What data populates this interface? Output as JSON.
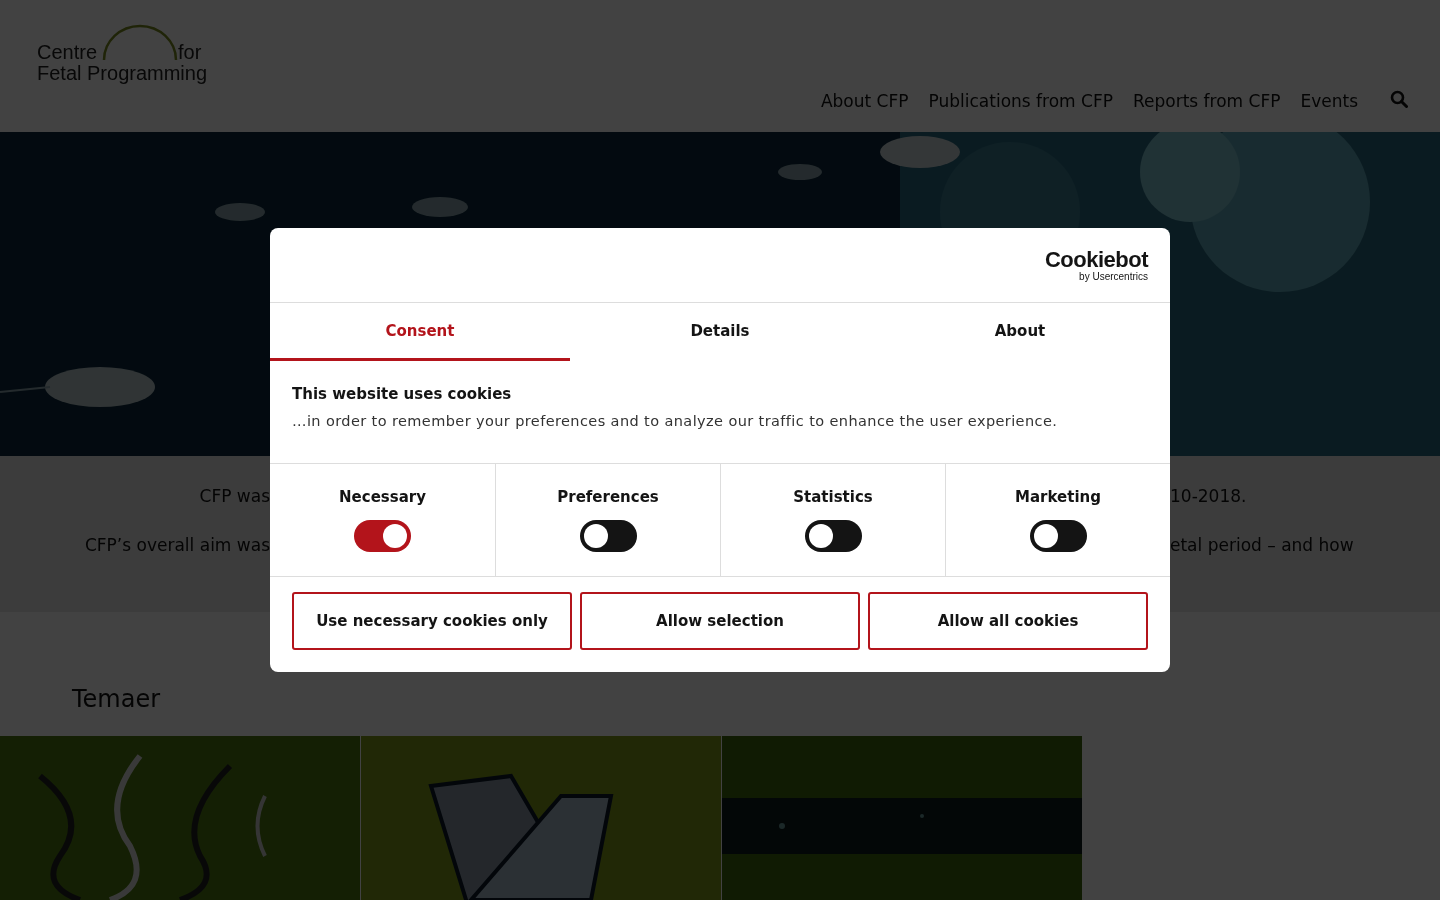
{
  "header": {
    "logo": {
      "line_1": "Centre",
      "line_1_end": "for",
      "line_2": "Fetal Programming"
    },
    "nav": [
      {
        "label": "About CFP"
      },
      {
        "label": "Publications from CFP"
      },
      {
        "label": "Reports from CFP"
      },
      {
        "label": "Events"
      }
    ]
  },
  "intro": {
    "lines": [
      {
        "left": "CFP was",
        "right": "10-2018."
      },
      {
        "left": "CFP’s overall aim was",
        "right": "etal period – and how"
      }
    ]
  },
  "themes": {
    "heading": "Temaer"
  },
  "cookie_dialog": {
    "brand": {
      "name": "Cookiebot",
      "byline": "by Usercentrics"
    },
    "tabs": [
      {
        "label": "Consent",
        "selected": true
      },
      {
        "label": "Details",
        "selected": false
      },
      {
        "label": "About",
        "selected": false
      }
    ],
    "title": "This website uses cookies",
    "description": "…in order to remember your preferences and to analyze our traffic to enhance the user experience.",
    "categories": [
      {
        "label": "Necessary",
        "checked": true
      },
      {
        "label": "Preferences",
        "checked": false
      },
      {
        "label": "Statistics",
        "checked": false
      },
      {
        "label": "Marketing",
        "checked": false
      }
    ],
    "buttons": [
      {
        "label": "Use necessary cookies only"
      },
      {
        "label": "Allow selection"
      },
      {
        "label": "Allow all cookies"
      }
    ]
  }
}
